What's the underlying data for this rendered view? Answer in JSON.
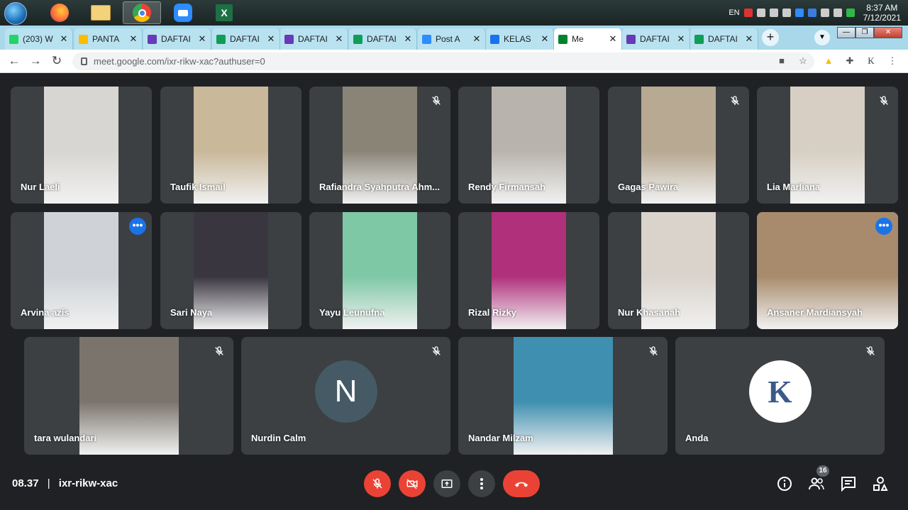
{
  "taskbar": {
    "tray_lang": "EN",
    "time": "8:37 AM",
    "date": "7/12/2021"
  },
  "tabs": [
    {
      "label": "(203) W",
      "color": "#25d366"
    },
    {
      "label": "PANTA",
      "color": "#fbbc04"
    },
    {
      "label": "DAFTAI",
      "color": "#673ab7"
    },
    {
      "label": "DAFTAI",
      "color": "#0f9d58"
    },
    {
      "label": "DAFTAI",
      "color": "#673ab7"
    },
    {
      "label": "DAFTAI",
      "color": "#0f9d58"
    },
    {
      "label": "Post A",
      "color": "#2d8cff"
    },
    {
      "label": "KELAS",
      "color": "#1a73e8"
    },
    {
      "label": "Me",
      "color": "#00832d",
      "active": true
    },
    {
      "label": "DAFTAI",
      "color": "#673ab7"
    },
    {
      "label": "DAFTAI",
      "color": "#0f9d58"
    }
  ],
  "address": {
    "url": "meet.google.com/ixr-rikw-xac?authuser=0"
  },
  "participants": [
    {
      "name": "Nur Laeli",
      "muted": false,
      "color": "#d8d6d2"
    },
    {
      "name": "Taufik Ismail",
      "muted": false,
      "color": "#c9b89a"
    },
    {
      "name": "Rafiandra Syahputra Ahm...",
      "muted": true,
      "color": "#8a8477"
    },
    {
      "name": "Rendy Firmansah",
      "muted": false,
      "color": "#b8b4ad"
    },
    {
      "name": "Gagas Pawira",
      "muted": true,
      "color": "#b7a992"
    },
    {
      "name": "Lia Marliana",
      "muted": true,
      "color": "#d7cfc4"
    },
    {
      "name": "Arvina azis",
      "muted": false,
      "color": "#cfd3d8",
      "more": true
    },
    {
      "name": "Sari Naya",
      "muted": false,
      "color": "#3a3640"
    },
    {
      "name": "Yayu Leunufna",
      "muted": false,
      "color": "#7fc8a6"
    },
    {
      "name": "Rizal Rizky",
      "muted": false,
      "color": "#b0307c"
    },
    {
      "name": "Nur Khasanah",
      "muted": false,
      "color": "#d9d3cb"
    },
    {
      "name": "Ansaner Mardiansyah",
      "muted": false,
      "color": "#a88b6c",
      "more": true,
      "speaking": true
    },
    {
      "name": "tara wulandari",
      "muted": true,
      "color": "#7a746c"
    },
    {
      "name": "Nurdin Calm",
      "muted": true,
      "avatar_letter": "N",
      "color": "#455a64"
    },
    {
      "name": "Nandar Milzam",
      "muted": true,
      "color": "#3f8fb0"
    },
    {
      "name": "Anda",
      "muted": true,
      "avatar_letter": "K",
      "color": "#ffffff"
    }
  ],
  "bottom": {
    "time": "08.37",
    "separator": "|",
    "meeting_code": "ixr-rikw-xac",
    "people_count": "16"
  }
}
